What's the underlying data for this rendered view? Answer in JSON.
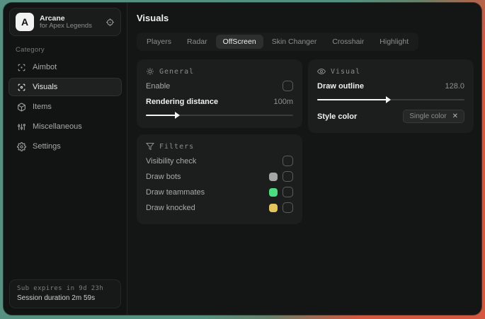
{
  "sidebar": {
    "logo_letter": "A",
    "app_name": "Arcane",
    "app_subtitle": "for Apex Legends",
    "category_label": "Category",
    "items": [
      {
        "label": "Aimbot"
      },
      {
        "label": "Visuals",
        "active": true
      },
      {
        "label": "Items"
      },
      {
        "label": "Miscellaneous"
      },
      {
        "label": "Settings"
      }
    ],
    "footer": {
      "sub_expires": "Sub expires in 9d 23h",
      "session_duration": "Session duration 2m 59s"
    }
  },
  "header": {
    "title": "Visuals"
  },
  "tabs": [
    {
      "label": "Players"
    },
    {
      "label": "Radar"
    },
    {
      "label": "OffScreen",
      "active": true
    },
    {
      "label": "Skin Changer"
    },
    {
      "label": "Crosshair"
    },
    {
      "label": "Highlight"
    }
  ],
  "panels": {
    "general": {
      "title": "General",
      "enable_label": "Enable",
      "enable_checked": false,
      "rendering_label": "Rendering distance",
      "rendering_value": "100m",
      "rendering_percent": "21%"
    },
    "visual": {
      "title": "Visual",
      "outline_label": "Draw outline",
      "outline_value": "128.0",
      "outline_percent": "48%",
      "style_label": "Style color",
      "style_selected": "Single color",
      "clear_glyph": "✕"
    },
    "filters": {
      "title": "Filters",
      "rows": [
        {
          "label": "Visibility check"
        },
        {
          "label": "Draw bots",
          "swatch": "#a6a6a6"
        },
        {
          "label": "Draw teammates",
          "swatch": "#4ade80"
        },
        {
          "label": "Draw knocked",
          "swatch": "#e3c45c"
        }
      ]
    }
  }
}
